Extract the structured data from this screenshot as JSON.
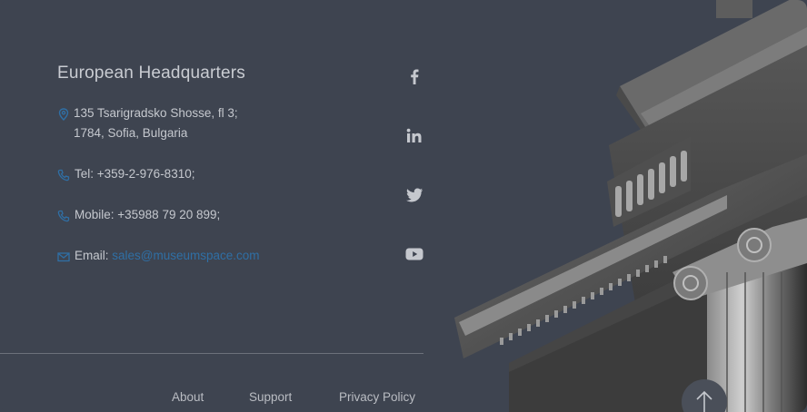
{
  "headquarters": {
    "title": "European Headquarters",
    "address_line1": "135 Tsarigradsko Shosse, fl 3;",
    "address_line2": "1784, Sofia, Bulgaria",
    "tel": "Tel: +359-2-976-8310;",
    "mobile": "Mobile: +35988 79 20 899;",
    "email_label": "Email:",
    "email_value": "sales@museumspace.com"
  },
  "social": [
    "facebook-icon",
    "linkedin-icon",
    "twitter-icon",
    "youtube-icon"
  ],
  "footer": {
    "links": [
      "About",
      "Support",
      "Privacy Policy"
    ]
  },
  "colors": {
    "background": "#3e4450",
    "accent": "#2f6fa5",
    "text": "#c9ccd2"
  }
}
